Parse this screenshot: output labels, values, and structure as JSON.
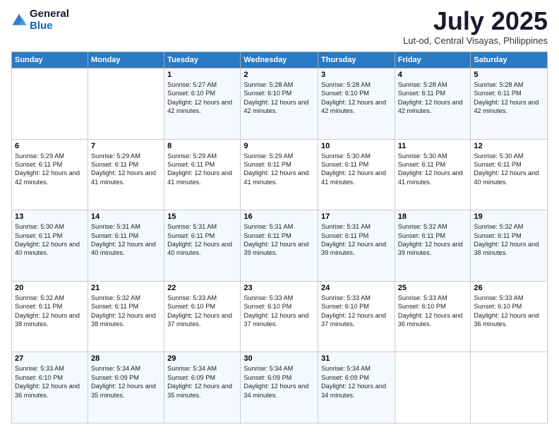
{
  "logo": {
    "general": "General",
    "blue": "Blue"
  },
  "title": "July 2025",
  "location": "Lut-od, Central Visayas, Philippines",
  "days_of_week": [
    "Sunday",
    "Monday",
    "Tuesday",
    "Wednesday",
    "Thursday",
    "Friday",
    "Saturday"
  ],
  "weeks": [
    [
      {
        "day": "",
        "sunrise": "",
        "sunset": "",
        "daylight": ""
      },
      {
        "day": "",
        "sunrise": "",
        "sunset": "",
        "daylight": ""
      },
      {
        "day": "1",
        "sunrise": "Sunrise: 5:27 AM",
        "sunset": "Sunset: 6:10 PM",
        "daylight": "Daylight: 12 hours and 42 minutes."
      },
      {
        "day": "2",
        "sunrise": "Sunrise: 5:28 AM",
        "sunset": "Sunset: 6:10 PM",
        "daylight": "Daylight: 12 hours and 42 minutes."
      },
      {
        "day": "3",
        "sunrise": "Sunrise: 5:28 AM",
        "sunset": "Sunset: 6:10 PM",
        "daylight": "Daylight: 12 hours and 42 minutes."
      },
      {
        "day": "4",
        "sunrise": "Sunrise: 5:28 AM",
        "sunset": "Sunset: 6:11 PM",
        "daylight": "Daylight: 12 hours and 42 minutes."
      },
      {
        "day": "5",
        "sunrise": "Sunrise: 5:28 AM",
        "sunset": "Sunset: 6:11 PM",
        "daylight": "Daylight: 12 hours and 42 minutes."
      }
    ],
    [
      {
        "day": "6",
        "sunrise": "Sunrise: 5:29 AM",
        "sunset": "Sunset: 6:11 PM",
        "daylight": "Daylight: 12 hours and 42 minutes."
      },
      {
        "day": "7",
        "sunrise": "Sunrise: 5:29 AM",
        "sunset": "Sunset: 6:11 PM",
        "daylight": "Daylight: 12 hours and 41 minutes."
      },
      {
        "day": "8",
        "sunrise": "Sunrise: 5:29 AM",
        "sunset": "Sunset: 6:11 PM",
        "daylight": "Daylight: 12 hours and 41 minutes."
      },
      {
        "day": "9",
        "sunrise": "Sunrise: 5:29 AM",
        "sunset": "Sunset: 6:11 PM",
        "daylight": "Daylight: 12 hours and 41 minutes."
      },
      {
        "day": "10",
        "sunrise": "Sunrise: 5:30 AM",
        "sunset": "Sunset: 6:11 PM",
        "daylight": "Daylight: 12 hours and 41 minutes."
      },
      {
        "day": "11",
        "sunrise": "Sunrise: 5:30 AM",
        "sunset": "Sunset: 6:11 PM",
        "daylight": "Daylight: 12 hours and 41 minutes."
      },
      {
        "day": "12",
        "sunrise": "Sunrise: 5:30 AM",
        "sunset": "Sunset: 6:11 PM",
        "daylight": "Daylight: 12 hours and 40 minutes."
      }
    ],
    [
      {
        "day": "13",
        "sunrise": "Sunrise: 5:30 AM",
        "sunset": "Sunset: 6:11 PM",
        "daylight": "Daylight: 12 hours and 40 minutes."
      },
      {
        "day": "14",
        "sunrise": "Sunrise: 5:31 AM",
        "sunset": "Sunset: 6:11 PM",
        "daylight": "Daylight: 12 hours and 40 minutes."
      },
      {
        "day": "15",
        "sunrise": "Sunrise: 5:31 AM",
        "sunset": "Sunset: 6:11 PM",
        "daylight": "Daylight: 12 hours and 40 minutes."
      },
      {
        "day": "16",
        "sunrise": "Sunrise: 5:31 AM",
        "sunset": "Sunset: 6:11 PM",
        "daylight": "Daylight: 12 hours and 39 minutes."
      },
      {
        "day": "17",
        "sunrise": "Sunrise: 5:31 AM",
        "sunset": "Sunset: 6:11 PM",
        "daylight": "Daylight: 12 hours and 39 minutes."
      },
      {
        "day": "18",
        "sunrise": "Sunrise: 5:32 AM",
        "sunset": "Sunset: 6:11 PM",
        "daylight": "Daylight: 12 hours and 39 minutes."
      },
      {
        "day": "19",
        "sunrise": "Sunrise: 5:32 AM",
        "sunset": "Sunset: 6:11 PM",
        "daylight": "Daylight: 12 hours and 38 minutes."
      }
    ],
    [
      {
        "day": "20",
        "sunrise": "Sunrise: 5:32 AM",
        "sunset": "Sunset: 6:11 PM",
        "daylight": "Daylight: 12 hours and 38 minutes."
      },
      {
        "day": "21",
        "sunrise": "Sunrise: 5:32 AM",
        "sunset": "Sunset: 6:11 PM",
        "daylight": "Daylight: 12 hours and 38 minutes."
      },
      {
        "day": "22",
        "sunrise": "Sunrise: 5:33 AM",
        "sunset": "Sunset: 6:10 PM",
        "daylight": "Daylight: 12 hours and 37 minutes."
      },
      {
        "day": "23",
        "sunrise": "Sunrise: 5:33 AM",
        "sunset": "Sunset: 6:10 PM",
        "daylight": "Daylight: 12 hours and 37 minutes."
      },
      {
        "day": "24",
        "sunrise": "Sunrise: 5:33 AM",
        "sunset": "Sunset: 6:10 PM",
        "daylight": "Daylight: 12 hours and 37 minutes."
      },
      {
        "day": "25",
        "sunrise": "Sunrise: 5:33 AM",
        "sunset": "Sunset: 6:10 PM",
        "daylight": "Daylight: 12 hours and 36 minutes."
      },
      {
        "day": "26",
        "sunrise": "Sunrise: 5:33 AM",
        "sunset": "Sunset: 6:10 PM",
        "daylight": "Daylight: 12 hours and 36 minutes."
      }
    ],
    [
      {
        "day": "27",
        "sunrise": "Sunrise: 5:33 AM",
        "sunset": "Sunset: 6:10 PM",
        "daylight": "Daylight: 12 hours and 36 minutes."
      },
      {
        "day": "28",
        "sunrise": "Sunrise: 5:34 AM",
        "sunset": "Sunset: 6:09 PM",
        "daylight": "Daylight: 12 hours and 35 minutes."
      },
      {
        "day": "29",
        "sunrise": "Sunrise: 5:34 AM",
        "sunset": "Sunset: 6:09 PM",
        "daylight": "Daylight: 12 hours and 35 minutes."
      },
      {
        "day": "30",
        "sunrise": "Sunrise: 5:34 AM",
        "sunset": "Sunset: 6:09 PM",
        "daylight": "Daylight: 12 hours and 34 minutes."
      },
      {
        "day": "31",
        "sunrise": "Sunrise: 5:34 AM",
        "sunset": "Sunset: 6:09 PM",
        "daylight": "Daylight: 12 hours and 34 minutes."
      },
      {
        "day": "",
        "sunrise": "",
        "sunset": "",
        "daylight": ""
      },
      {
        "day": "",
        "sunrise": "",
        "sunset": "",
        "daylight": ""
      }
    ]
  ]
}
